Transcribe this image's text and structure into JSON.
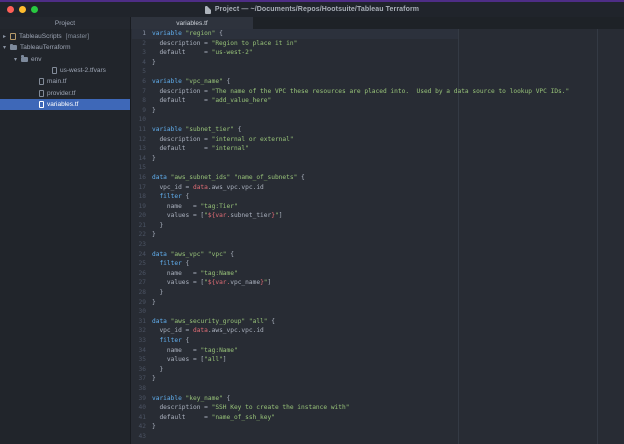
{
  "window": {
    "title": "Project — ~/Documents/Repos/Hootsuite/Tableau Terraform",
    "traffic_lights": [
      "close",
      "minimize",
      "zoom"
    ]
  },
  "colors": {
    "editor_bg": "#282c34",
    "sidebar_bg": "#21252b",
    "selection_blue": "#3e68b8",
    "keyword_blue": "#61afef",
    "string_green": "#98c379",
    "interpolation_red": "#e06c75",
    "top_accent": "#4e2d86",
    "traffic_red": "#ff5f57",
    "traffic_yellow": "#febc2e",
    "traffic_green": "#28c840"
  },
  "sidebar": {
    "header": "Project",
    "tree": [
      {
        "label": "TableauScripts",
        "suffix": "[master]",
        "icon": "repo",
        "arrow": "collapsed",
        "indent": 0,
        "selected": false
      },
      {
        "label": "TableauTerraform",
        "icon": "folder",
        "arrow": "expanded",
        "indent": 0,
        "selected": false
      },
      {
        "label": "env",
        "icon": "folder",
        "arrow": "expanded",
        "indent": 1,
        "selected": false
      },
      {
        "label": "us-west-2.tfvars",
        "icon": "file",
        "indent": 2,
        "selected": false
      },
      {
        "label": "main.tf",
        "icon": "file",
        "indent": 1,
        "selected": false
      },
      {
        "label": "provider.tf",
        "icon": "file",
        "indent": 1,
        "selected": false
      },
      {
        "label": "variables.tf",
        "icon": "file",
        "indent": 1,
        "selected": true
      }
    ]
  },
  "editor": {
    "tab": "variables.tf",
    "active_line": 1,
    "total_lines": 43,
    "code": [
      [
        [
          "k",
          "variable"
        ],
        [
          "d",
          " "
        ],
        [
          "s",
          "\"region\""
        ],
        [
          "d",
          " {"
        ]
      ],
      [
        [
          "d",
          "  description = "
        ],
        [
          "s",
          "\"Region to place it in\""
        ]
      ],
      [
        [
          "d",
          "  default     = "
        ],
        [
          "s",
          "\"us-west-2\""
        ]
      ],
      [
        [
          "d",
          "}"
        ]
      ],
      [],
      [
        [
          "k",
          "variable"
        ],
        [
          "d",
          " "
        ],
        [
          "s",
          "\"vpc_name\""
        ],
        [
          "d",
          " {"
        ]
      ],
      [
        [
          "d",
          "  description = "
        ],
        [
          "s",
          "\"The name of the VPC these resources are placed into.  Used by a data source to lookup VPC IDs.\""
        ]
      ],
      [
        [
          "d",
          "  default     = "
        ],
        [
          "s",
          "\"add_value_here\""
        ]
      ],
      [
        [
          "d",
          "}"
        ]
      ],
      [],
      [
        [
          "k",
          "variable"
        ],
        [
          "d",
          " "
        ],
        [
          "s",
          "\"subnet_tier\""
        ],
        [
          "d",
          " {"
        ]
      ],
      [
        [
          "d",
          "  description = "
        ],
        [
          "s",
          "\"internal or external\""
        ]
      ],
      [
        [
          "d",
          "  default     = "
        ],
        [
          "s",
          "\"internal\""
        ]
      ],
      [
        [
          "d",
          "}"
        ]
      ],
      [],
      [
        [
          "k",
          "data"
        ],
        [
          "d",
          " "
        ],
        [
          "s",
          "\"aws_subnet_ids\""
        ],
        [
          "d",
          " "
        ],
        [
          "s",
          "\"name_of_subnets\""
        ],
        [
          "d",
          " {"
        ]
      ],
      [
        [
          "d",
          "  vpc_id = "
        ],
        [
          "r",
          "data"
        ],
        [
          "d",
          ".aws_vpc.vpc.id"
        ]
      ],
      [
        [
          "d",
          "  "
        ],
        [
          "k",
          "filter"
        ],
        [
          "d",
          " {"
        ]
      ],
      [
        [
          "d",
          "    name   = "
        ],
        [
          "s",
          "\"tag:Tier\""
        ]
      ],
      [
        [
          "d",
          "    values = ["
        ],
        [
          "s",
          "\""
        ],
        [
          "r",
          "${var."
        ],
        [
          "d",
          "subnet_tier"
        ],
        [
          "r",
          "}"
        ],
        [
          "s",
          "\""
        ],
        [
          "d",
          "]"
        ]
      ],
      [
        [
          "d",
          "  }"
        ]
      ],
      [
        [
          "d",
          "}"
        ]
      ],
      [],
      [
        [
          "k",
          "data"
        ],
        [
          "d",
          " "
        ],
        [
          "s",
          "\"aws_vpc\""
        ],
        [
          "d",
          " "
        ],
        [
          "s",
          "\"vpc\""
        ],
        [
          "d",
          " {"
        ]
      ],
      [
        [
          "d",
          "  "
        ],
        [
          "k",
          "filter"
        ],
        [
          "d",
          " {"
        ]
      ],
      [
        [
          "d",
          "    name   = "
        ],
        [
          "s",
          "\"tag:Name\""
        ]
      ],
      [
        [
          "d",
          "    values = ["
        ],
        [
          "s",
          "\""
        ],
        [
          "r",
          "${var."
        ],
        [
          "d",
          "vpc_name"
        ],
        [
          "r",
          "}"
        ],
        [
          "s",
          "\""
        ],
        [
          "d",
          "]"
        ]
      ],
      [
        [
          "d",
          "  }"
        ]
      ],
      [
        [
          "d",
          "}"
        ]
      ],
      [],
      [
        [
          "k",
          "data"
        ],
        [
          "d",
          " "
        ],
        [
          "s",
          "\"aws_security_group\""
        ],
        [
          "d",
          " "
        ],
        [
          "s",
          "\"all\""
        ],
        [
          "d",
          " {"
        ]
      ],
      [
        [
          "d",
          "  vpc_id = "
        ],
        [
          "r",
          "data"
        ],
        [
          "d",
          ".aws_vpc.vpc.id"
        ]
      ],
      [
        [
          "d",
          "  "
        ],
        [
          "k",
          "filter"
        ],
        [
          "d",
          " {"
        ]
      ],
      [
        [
          "d",
          "    name   = "
        ],
        [
          "s",
          "\"tag:Name\""
        ]
      ],
      [
        [
          "d",
          "    values = ["
        ],
        [
          "s",
          "\"all\""
        ],
        [
          "d",
          "]"
        ]
      ],
      [
        [
          "d",
          "  }"
        ]
      ],
      [
        [
          "d",
          "}"
        ]
      ],
      [],
      [
        [
          "k",
          "variable"
        ],
        [
          "d",
          " "
        ],
        [
          "s",
          "\"key_name\""
        ],
        [
          "d",
          " {"
        ]
      ],
      [
        [
          "d",
          "  description = "
        ],
        [
          "s",
          "\"SSH Key to create the instance with\""
        ]
      ],
      [
        [
          "d",
          "  default     = "
        ],
        [
          "s",
          "\"name_of_ssh_key\""
        ]
      ],
      [
        [
          "d",
          "}"
        ]
      ],
      []
    ]
  }
}
